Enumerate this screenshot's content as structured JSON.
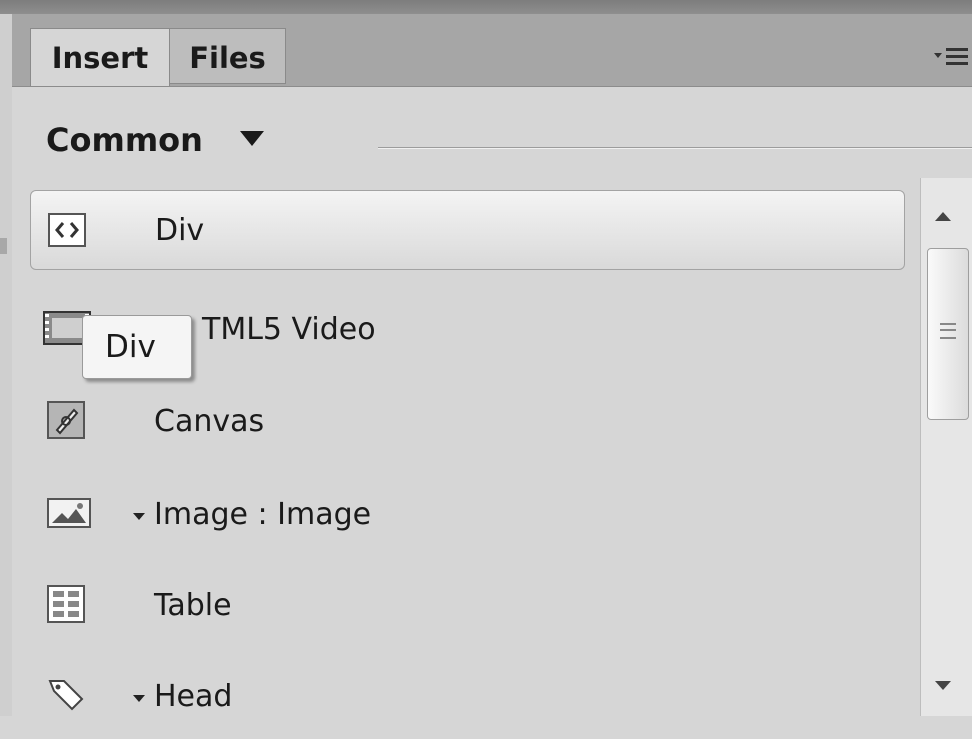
{
  "tabs": {
    "insert_label": "Insert",
    "files_label": "Files"
  },
  "panel_menu_icon": "panel-options-icon",
  "category": {
    "label": "Common"
  },
  "items": [
    {
      "label": "Div",
      "icon": "div-icon",
      "selected": true
    },
    {
      "label": "TML5 Video",
      "icon": "html5-video-icon"
    },
    {
      "label": "Canvas",
      "icon": "canvas-icon"
    },
    {
      "label": "Image : Image",
      "icon": "image-icon",
      "has_dropdown": true
    },
    {
      "label": "Table",
      "icon": "table-icon"
    },
    {
      "label": "Head",
      "icon": "head-tag-icon",
      "has_dropdown": true
    }
  ],
  "tooltip": {
    "text": "Div"
  },
  "colors": {
    "panel_bg": "#d6d6d6",
    "tabbar_bg": "#a6a6a6"
  }
}
